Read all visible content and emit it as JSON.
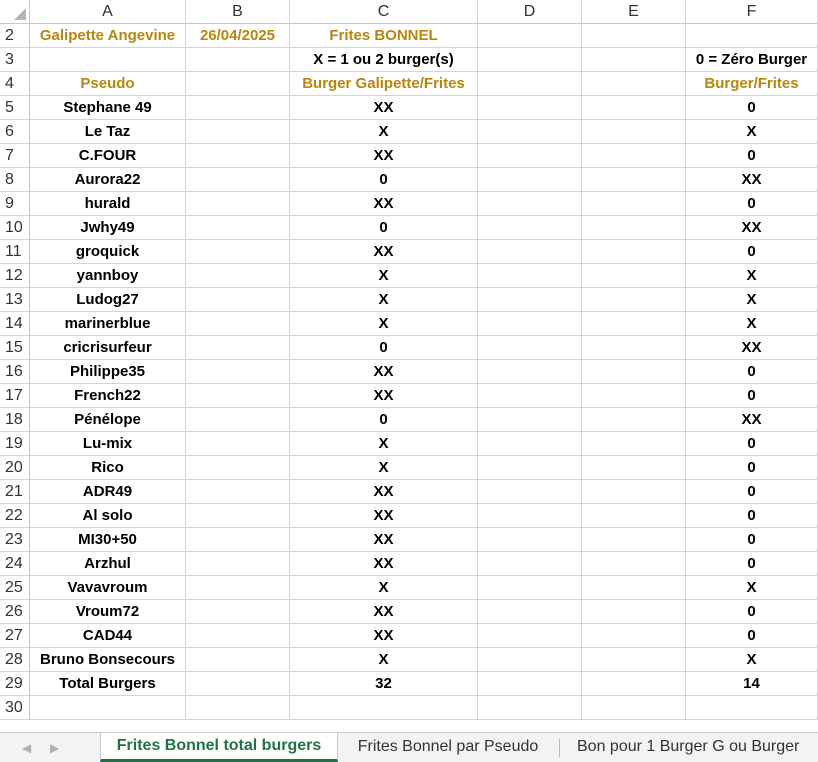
{
  "columns": [
    "A",
    "B",
    "C",
    "D",
    "E",
    "F"
  ],
  "rows": [
    {
      "num": "2",
      "cells": [
        "Galipette Angevine",
        "26/04/2025",
        "Frites BONNEL",
        "",
        "",
        ""
      ]
    },
    {
      "num": "3",
      "cells": [
        "",
        "",
        "X = 1 ou 2 burger(s)",
        "",
        "",
        "0 = Zéro Burger"
      ]
    },
    {
      "num": "4",
      "cells": [
        "Pseudo",
        "",
        "Burger Galipette/Frites",
        "",
        "",
        "Burger/Frites"
      ]
    },
    {
      "num": "5",
      "cells": [
        "Stephane 49",
        "",
        "XX",
        "",
        "",
        "0"
      ]
    },
    {
      "num": "6",
      "cells": [
        "Le Taz",
        "",
        "X",
        "",
        "",
        "X"
      ]
    },
    {
      "num": "7",
      "cells": [
        "C.FOUR",
        "",
        "XX",
        "",
        "",
        "0"
      ]
    },
    {
      "num": "8",
      "cells": [
        "Aurora22",
        "",
        "0",
        "",
        "",
        "XX"
      ]
    },
    {
      "num": "9",
      "cells": [
        "hurald",
        "",
        "XX",
        "",
        "",
        "0"
      ]
    },
    {
      "num": "10",
      "cells": [
        "Jwhy49",
        "",
        "0",
        "",
        "",
        "XX"
      ]
    },
    {
      "num": "11",
      "cells": [
        "groquick",
        "",
        "XX",
        "",
        "",
        "0"
      ]
    },
    {
      "num": "12",
      "cells": [
        "yannboy",
        "",
        "X",
        "",
        "",
        "X"
      ]
    },
    {
      "num": "13",
      "cells": [
        "Ludog27",
        "",
        "X",
        "",
        "",
        "X"
      ]
    },
    {
      "num": "14",
      "cells": [
        "marinerblue",
        "",
        "X",
        "",
        "",
        "X"
      ]
    },
    {
      "num": "15",
      "cells": [
        "cricrisurfeur",
        "",
        "0",
        "",
        "",
        "XX"
      ]
    },
    {
      "num": "16",
      "cells": [
        "Philippe35",
        "",
        "XX",
        "",
        "",
        "0"
      ]
    },
    {
      "num": "17",
      "cells": [
        "French22",
        "",
        "XX",
        "",
        "",
        "0"
      ]
    },
    {
      "num": "18",
      "cells": [
        "Pénélope",
        "",
        "0",
        "",
        "",
        "XX"
      ]
    },
    {
      "num": "19",
      "cells": [
        "Lu-mix",
        "",
        "X",
        "",
        "",
        "0"
      ]
    },
    {
      "num": "20",
      "cells": [
        "Rico",
        "",
        "X",
        "",
        "",
        "0"
      ]
    },
    {
      "num": "21",
      "cells": [
        "ADR49",
        "",
        "XX",
        "",
        "",
        "0"
      ]
    },
    {
      "num": "22",
      "cells": [
        "Al solo",
        "",
        "XX",
        "",
        "",
        "0"
      ]
    },
    {
      "num": "23",
      "cells": [
        "MI30+50",
        "",
        "XX",
        "",
        "",
        "0"
      ]
    },
    {
      "num": "24",
      "cells": [
        "Arzhul",
        "",
        "XX",
        "",
        "",
        "0"
      ]
    },
    {
      "num": "25",
      "cells": [
        "Vavavroum",
        "",
        "X",
        "",
        "",
        "X"
      ]
    },
    {
      "num": "26",
      "cells": [
        "Vroum72",
        "",
        "XX",
        "",
        "",
        "0"
      ]
    },
    {
      "num": "27",
      "cells": [
        "CAD44",
        "",
        "XX",
        "",
        "",
        "0"
      ]
    },
    {
      "num": "28",
      "cells": [
        "Bruno Bonsecours",
        "",
        "X",
        "",
        "",
        "X"
      ]
    },
    {
      "num": "29",
      "cells": [
        "Total Burgers",
        "",
        "32",
        "",
        "",
        "14"
      ]
    },
    {
      "num": "30",
      "cells": [
        "",
        "",
        "",
        "",
        "",
        ""
      ]
    }
  ],
  "colors": {
    "header_text": "#b8860b",
    "active_tab": "#217346"
  },
  "sheet_tabs": [
    {
      "label": "Frites Bonnel total burgers",
      "active": true
    },
    {
      "label": "Frites Bonnel par Pseudo",
      "active": false
    },
    {
      "label": "Bon pour 1 Burger G ou Burger",
      "active": false
    }
  ],
  "nav_icons": [
    "scroll-left-icon",
    "scroll-right-icon"
  ]
}
